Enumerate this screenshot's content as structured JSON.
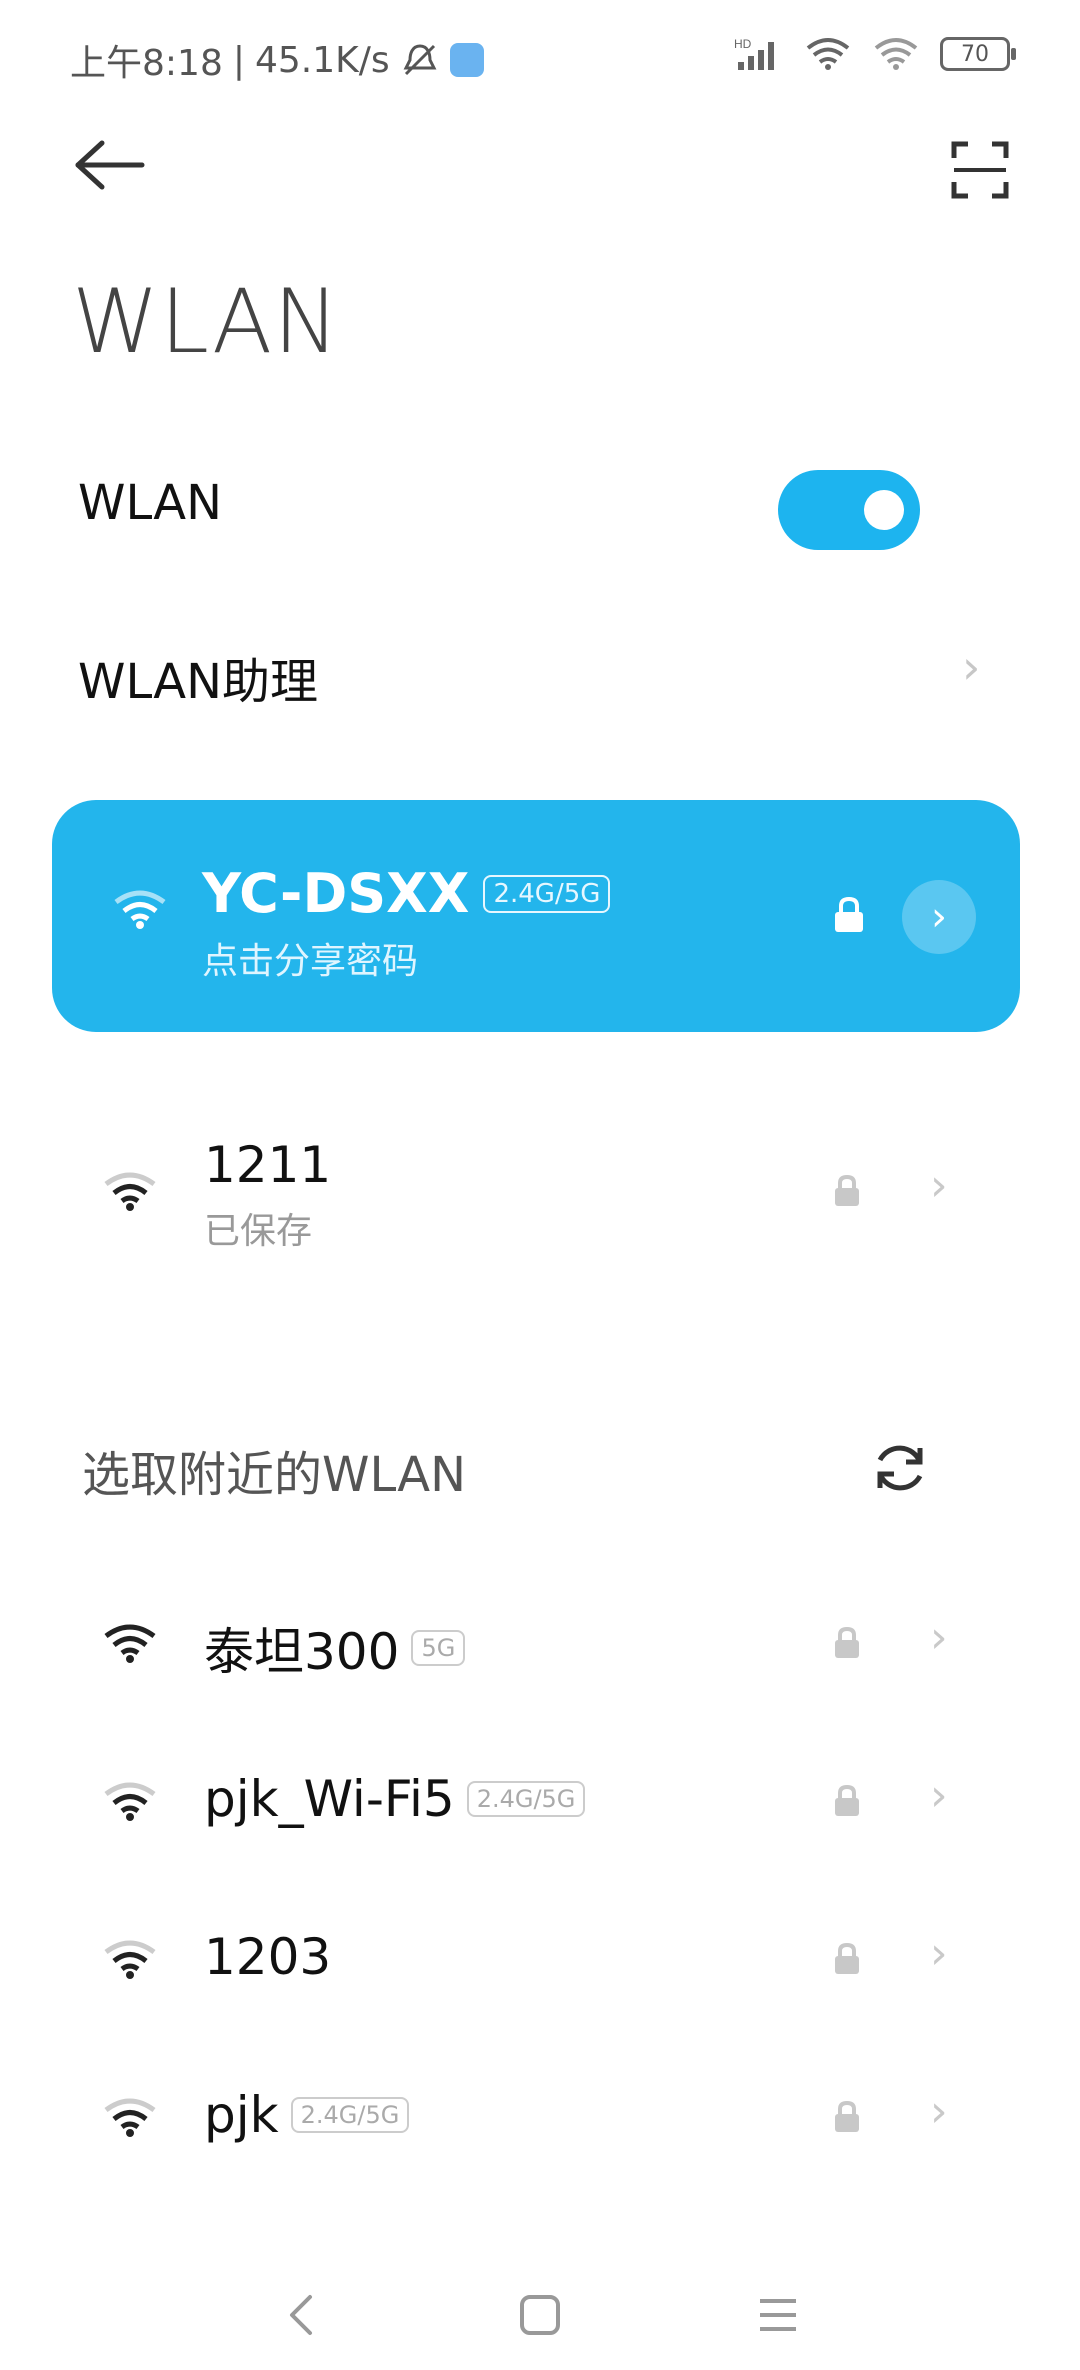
{
  "status": {
    "time": "上午8:18",
    "speed": "45.1K/s",
    "battery": "70",
    "hd": "HD"
  },
  "header": {
    "title": "WLAN"
  },
  "settings": {
    "wlan_label": "WLAN",
    "wlan_on": true,
    "assistant_label": "WLAN助理"
  },
  "connected": {
    "ssid": "YC-DSXX",
    "band": "2.4G/5G",
    "subtitle": "点击分享密码"
  },
  "saved": [
    {
      "ssid": "1211",
      "status": "已保存"
    }
  ],
  "nearby_title": "选取附近的WLAN",
  "nearby": [
    {
      "ssid": "泰坦300",
      "band": "5G"
    },
    {
      "ssid": "pjk_Wi-Fi5",
      "band": "2.4G/5G"
    },
    {
      "ssid": "1203",
      "band": ""
    },
    {
      "ssid": "pjk",
      "band": "2.4G/5G"
    }
  ],
  "colors": {
    "accent": "#23b5ec",
    "toggle": "#1db4ef"
  }
}
